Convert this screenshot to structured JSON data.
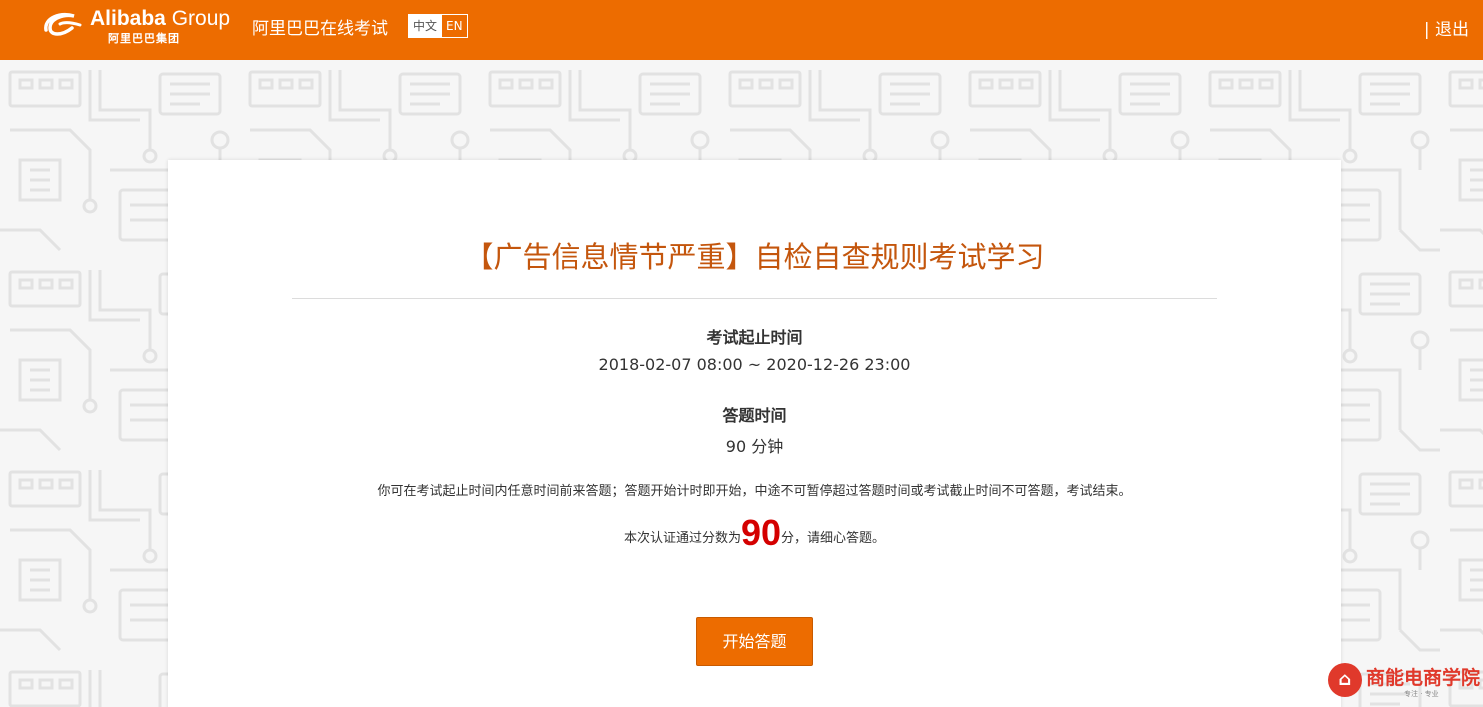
{
  "header": {
    "brand_bold": "Alibaba",
    "brand_light": "Group",
    "brand_sub": "阿里巴巴集团",
    "site_title": "阿里巴巴在线考试",
    "lang_zh": "中文",
    "lang_en": "EN",
    "logout": "| 退出"
  },
  "exam": {
    "title": "【广告信息情节严重】自检自查规则考试学习",
    "period_label": "考试起止时间",
    "period_value": "2018-02-07 08:00 ~ 2020-12-26 23:00",
    "duration_label": "答题时间",
    "duration_value": "90 分钟",
    "note": "你可在考试起止时间内任意时间前来答题；答题开始计时即开始，中途不可暂停超过答题时间或考试截止时间不可答题，考试结束。",
    "pass_prefix": "本次认证通过分数为",
    "pass_score": "90",
    "pass_suffix": "分，请细心答题。",
    "start_button": "开始答题"
  },
  "watermark": {
    "name": "商能电商学院",
    "slogan": "专注 · 专业"
  },
  "colors": {
    "brand_orange": "#ed6c00",
    "title_orange": "#c4560d",
    "score_red": "#d40000"
  }
}
